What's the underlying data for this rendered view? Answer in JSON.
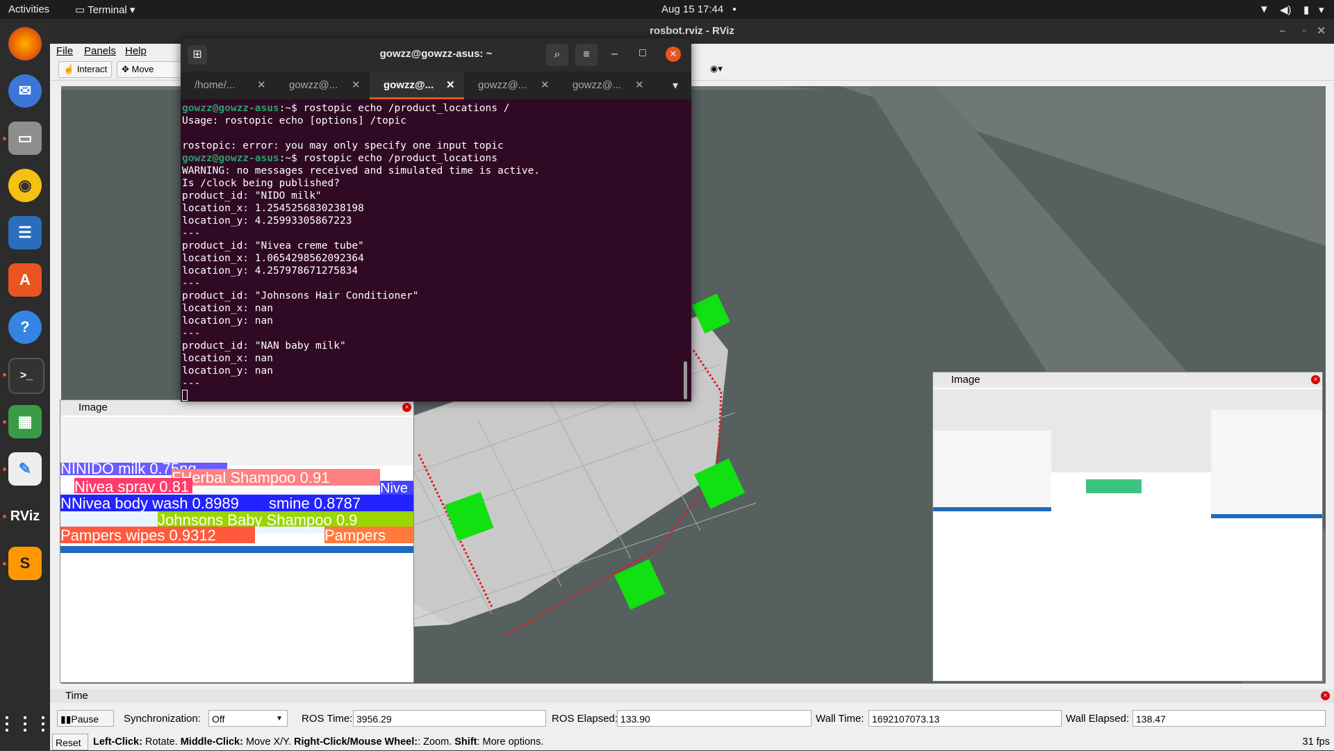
{
  "topbar": {
    "activities": "Activities",
    "app": "Terminal",
    "datetime": "Aug 15  17:44"
  },
  "dock": {
    "items": [
      "firefox",
      "thunderbird",
      "files",
      "rhythmbox",
      "writer",
      "app-center",
      "help",
      "terminal",
      "calc",
      "text-editor",
      "rviz",
      "sublime",
      "app-grid"
    ]
  },
  "rviz": {
    "title": "rosbot.rviz - RViz",
    "menu": {
      "file": "File",
      "panels": "Panels",
      "help": "Help"
    },
    "tools": {
      "interact": "Interact",
      "move_camera": "Move Camer"
    },
    "image_panel_left": {
      "title": "Image",
      "labels": [
        "NINIDO milk 0.75ng",
        "FHerbal Shampoo 0.91",
        "Nivea spray 0.81",
        "Nive",
        "NNivea body wash 0.8989",
        "smine 0.8787",
        "Johnsons Baby Shampoo 0.9",
        "Pampers wipes 0.9312",
        "Pampers"
      ]
    },
    "image_panel_right": {
      "title": "Image"
    },
    "time_panel": {
      "title": "Time",
      "pause": "Pause",
      "sync_label": "Synchronization:",
      "sync_value": "Off",
      "ros_time_label": "ROS Time:",
      "ros_time": "3956.29",
      "ros_elapsed_label": "ROS Elapsed:",
      "ros_elapsed": "133.90",
      "wall_time_label": "Wall Time:",
      "wall_time": "1692107073.13",
      "wall_elapsed_label": "Wall Elapsed:",
      "wall_elapsed": "138.47"
    },
    "status": {
      "reset": "Reset",
      "hint_b1": "Left-Click:",
      "hint_t1": " Rotate. ",
      "hint_b2": "Middle-Click:",
      "hint_t2": " Move X/Y. ",
      "hint_b3": "Right-Click/Mouse Wheel:",
      "hint_t3": ": Zoom. ",
      "hint_b4": "Shift",
      "hint_t4": ": More options.",
      "fps": "31 fps"
    }
  },
  "terminal": {
    "title": "gowzz@gowzz-asus: ~",
    "tabs": [
      "/home/...",
      "gowzz@...",
      "gowzz@...",
      "gowzz@...",
      "gowzz@..."
    ],
    "prompt": "gowzz@gowzz-asus",
    "lines": [
      {
        "p": true,
        "t": ":~$ rostopic echo /product_locations /"
      },
      {
        "p": false,
        "t": "Usage: rostopic echo [options] /topic"
      },
      {
        "p": false,
        "t": ""
      },
      {
        "p": false,
        "t": "rostopic: error: you may only specify one input topic"
      },
      {
        "p": true,
        "t": ":~$ rostopic echo /product_locations"
      },
      {
        "p": false,
        "t": "WARNING: no messages received and simulated time is active."
      },
      {
        "p": false,
        "t": "Is /clock being published?"
      },
      {
        "p": false,
        "t": "product_id: \"NIDO milk\""
      },
      {
        "p": false,
        "t": "location_x: 1.2545256830238198"
      },
      {
        "p": false,
        "t": "location_y: 4.25993305867223"
      },
      {
        "p": false,
        "t": "---"
      },
      {
        "p": false,
        "t": "product_id: \"Nivea creme tube\""
      },
      {
        "p": false,
        "t": "location_x: 1.0654298562092364"
      },
      {
        "p": false,
        "t": "location_y: 4.257978671275834"
      },
      {
        "p": false,
        "t": "---"
      },
      {
        "p": false,
        "t": "product_id: \"Johnsons Hair Conditioner\""
      },
      {
        "p": false,
        "t": "location_x: nan"
      },
      {
        "p": false,
        "t": "location_y: nan"
      },
      {
        "p": false,
        "t": "---"
      },
      {
        "p": false,
        "t": "product_id: \"NAN baby milk\""
      },
      {
        "p": false,
        "t": "location_x: nan"
      },
      {
        "p": false,
        "t": "location_y: nan"
      },
      {
        "p": false,
        "t": "---"
      }
    ]
  }
}
